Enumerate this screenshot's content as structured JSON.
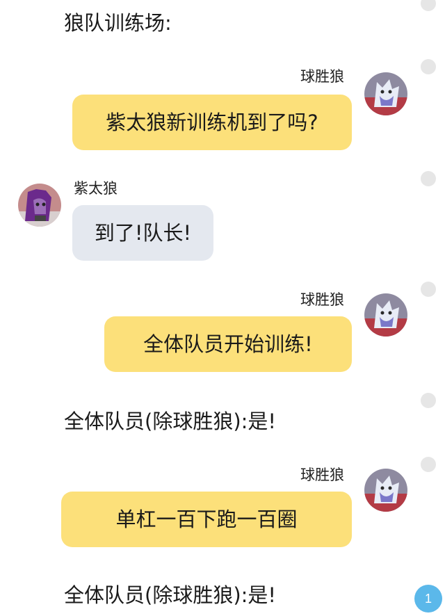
{
  "narration_1": "狼队训练场:",
  "messages": [
    {
      "sender": "球胜狼",
      "text": "紫太狼新训练机到了吗?"
    },
    {
      "sender": "紫太狼",
      "text": "到了!队长!"
    },
    {
      "sender": "球胜狼",
      "text": "全体队员开始训练!"
    },
    {
      "sender": "球胜狼",
      "text": "单杠一百下跑一百圈"
    }
  ],
  "narration_2": "全体队员(除球胜狼):是!",
  "narration_3": "全体队员(除球胜狼):是!",
  "unread_badge": "1",
  "colors": {
    "right_bubble": "#fce07a",
    "left_bubble": "#e4e8ef",
    "badge": "#5bb8ea",
    "side_dot": "#e6e6e6"
  }
}
